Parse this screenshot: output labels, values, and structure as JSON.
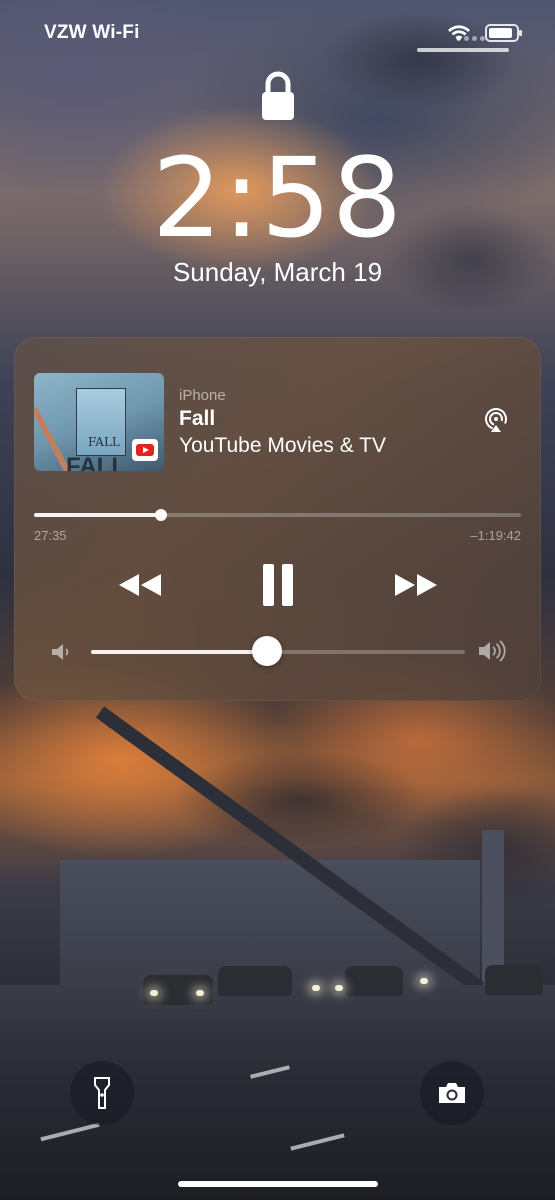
{
  "status_bar": {
    "carrier": "VZW Wi-Fi",
    "wifi_icon": "wifi-icon",
    "battery_icon": "battery-icon",
    "battery_level": 0.9
  },
  "lock_screen": {
    "lock_icon": "lock-icon",
    "time": "2:58",
    "date": "Sunday, March 19"
  },
  "now_playing": {
    "source": "iPhone",
    "title": "Fall",
    "subtitle": "YouTube Movies & TV",
    "artwork_title": "FALL",
    "artwork_big_text": "FALL",
    "app_badge_icon": "youtube-icon",
    "airplay_icon": "airplay-icon",
    "elapsed": "27:35",
    "remaining": "–1:19:42",
    "progress": 0.26,
    "volume": 0.47,
    "controls": {
      "rewind_icon": "rewind-icon",
      "pause_icon": "pause-icon",
      "forward_icon": "fast-forward-icon"
    },
    "volume_low_icon": "speaker-low-icon",
    "volume_high_icon": "speaker-high-icon"
  },
  "quick_actions": {
    "flashlight_icon": "flashlight-icon",
    "camera_icon": "camera-icon"
  },
  "colors": {
    "card": "#6b5244",
    "youtube_red": "#e32222"
  }
}
